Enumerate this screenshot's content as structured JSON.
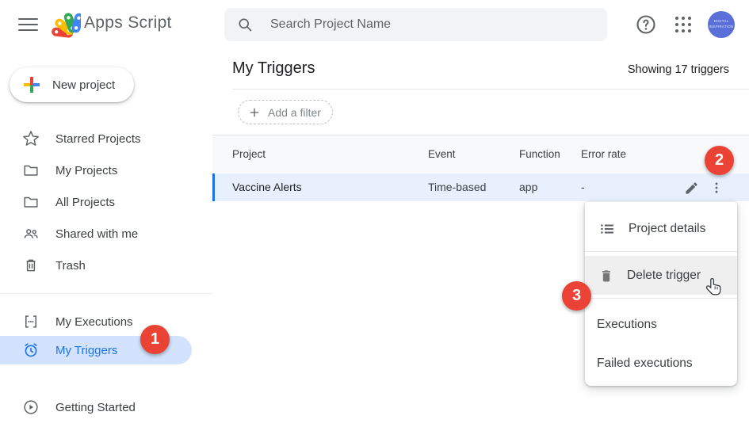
{
  "topbar": {
    "app_name": "Apps Script",
    "search_placeholder": "Search Project Name",
    "avatar_line1": "DIGITAL",
    "avatar_line2": "INSPIRATION"
  },
  "sidebar": {
    "new_project_label": "New project",
    "items": [
      {
        "label": "Starred Projects"
      },
      {
        "label": "My Projects"
      },
      {
        "label": "All Projects"
      },
      {
        "label": "Shared with me"
      },
      {
        "label": "Trash"
      }
    ],
    "items_bottom": [
      {
        "label": "My Executions"
      },
      {
        "label": "My Triggers"
      },
      {
        "label": "Getting Started"
      }
    ]
  },
  "main": {
    "title": "My Triggers",
    "count_label": "Showing 17 triggers",
    "filter_chip_label": "Add a filter",
    "table": {
      "headers": [
        "Project",
        "Event",
        "Function",
        "Error rate"
      ],
      "rows": [
        {
          "project": "Vaccine Alerts",
          "event": "Time-based",
          "function": "app",
          "error_rate": "-"
        }
      ]
    }
  },
  "context_menu": {
    "items": [
      {
        "label": "Project details"
      },
      {
        "label": "Delete trigger"
      },
      {
        "label": "Executions"
      },
      {
        "label": "Failed executions"
      }
    ]
  },
  "badges": {
    "step1": "1",
    "step2": "2",
    "step3": "3"
  },
  "colors": {
    "accent_blue": "#1a73e8",
    "selected_pill_bg": "#d3e3fd",
    "row_highlight_bg": "#e8f0fe",
    "badge_red": "#ea4335",
    "search_bg": "#f1f3f4",
    "table_header_bg": "#f8f9fa",
    "avatar_bg": "#5a6fd8"
  }
}
